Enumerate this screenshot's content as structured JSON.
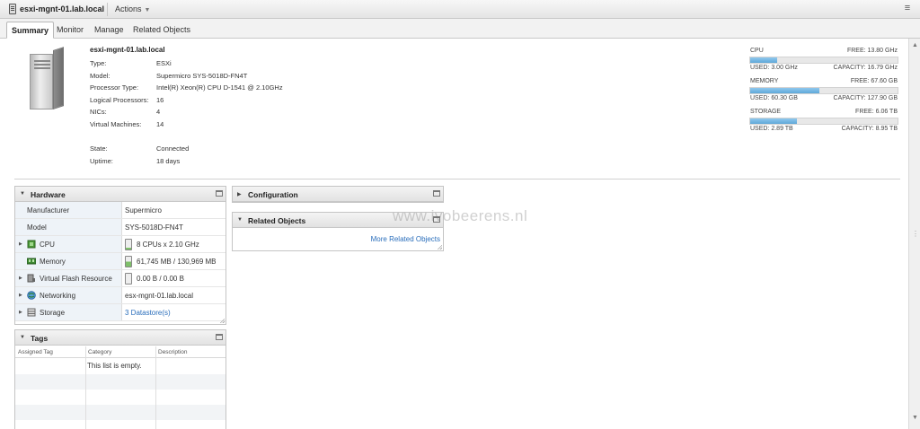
{
  "titlebar": {
    "host_title": "esxi-mgnt-01.lab.local",
    "actions_label": "Actions",
    "menu_icon": "list-menu-icon"
  },
  "tabs": [
    {
      "label": "Summary",
      "active": true
    },
    {
      "label": "Monitor",
      "active": false
    },
    {
      "label": "Manage",
      "active": false
    },
    {
      "label": "Related Objects",
      "active": false
    }
  ],
  "summary": {
    "host_name": "esxi-mgnt-01.lab.local",
    "properties": [
      {
        "label": "Type:",
        "value": "ESXi"
      },
      {
        "label": "Model:",
        "value": "Supermicro SYS-5018D-FN4T"
      },
      {
        "label": "Processor Type:",
        "value": "Intel(R) Xeon(R) CPU D-1541 @ 2.10GHz"
      },
      {
        "label": "Logical Processors:",
        "value": "16"
      },
      {
        "label": "NICs:",
        "value": "4"
      },
      {
        "label": "Virtual Machines:",
        "value": "14"
      },
      {
        "label": "State:",
        "value": "Connected"
      },
      {
        "label": "Uptime:",
        "value": "18 days"
      }
    ]
  },
  "resources": [
    {
      "name": "CPU",
      "free": "FREE: 13.80 GHz",
      "used": "USED: 3.00 GHz",
      "capacity": "CAPACITY: 16.79 GHz",
      "fill": 0.18
    },
    {
      "name": "MEMORY",
      "free": "FREE: 67.60 GB",
      "used": "USED: 60.30 GB",
      "capacity": "CAPACITY: 127.90 GB",
      "fill": 0.47
    },
    {
      "name": "STORAGE",
      "free": "FREE: 6.06 TB",
      "used": "USED: 2.89 TB",
      "capacity": "CAPACITY: 8.95 TB",
      "fill": 0.32
    }
  ],
  "hardware": {
    "title": "Hardware",
    "rows": [
      {
        "label": "Manufacturer",
        "value": "Supermicro"
      },
      {
        "label": "Model",
        "value": "SYS-5018D-FN4T"
      },
      {
        "label": "CPU",
        "value": "8 CPUs x 2.10 GHz"
      },
      {
        "label": "Memory",
        "value": "61,745 MB / 130,969 MB"
      },
      {
        "label": "Virtual Flash Resource",
        "value": "0.00 B / 0.00 B"
      },
      {
        "label": "Networking",
        "value": "esx-mgnt-01.lab.local"
      },
      {
        "label": "Storage",
        "value": "3 Datastore(s)"
      }
    ]
  },
  "tags": {
    "title": "Tags",
    "columns": [
      "Assigned Tag",
      "Category",
      "Description"
    ],
    "empty_text": "This list is empty."
  },
  "configuration": {
    "title": "Configuration"
  },
  "related_objects": {
    "title": "Related Objects",
    "link": "More Related Objects"
  },
  "watermark": "www.ivobeerens.nl",
  "colors": {
    "accent": "#2a6ebb",
    "meter_fill": "#5fa8d8"
  }
}
